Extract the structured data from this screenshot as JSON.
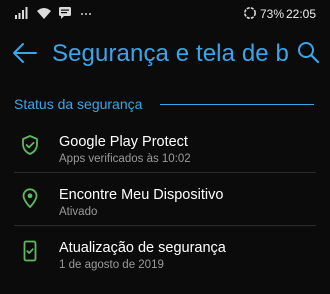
{
  "status_bar": {
    "battery_percent": "73%",
    "time": "22:05",
    "left_icons": [
      "signal-icon",
      "wifi-icon",
      "message-icon",
      "more-notifications-icon"
    ],
    "right_icons": [
      "battery-saver-icon"
    ]
  },
  "toolbar": {
    "title": "Segurança e tela de blo...",
    "back_icon": "back-arrow-icon",
    "search_icon": "search-icon"
  },
  "section": {
    "title": "Status da segurança"
  },
  "items": [
    {
      "icon": "shield-check-icon",
      "title": "Google Play Protect",
      "subtitle": "Apps verificados às 10:02"
    },
    {
      "icon": "location-pin-icon",
      "title": "Encontre Meu Dispositivo",
      "subtitle": "Ativado"
    },
    {
      "icon": "phone-update-icon",
      "title": "Atualização de segurança",
      "subtitle": "1 de agosto de 2019"
    }
  ],
  "colors": {
    "accent": "#3aa6ea",
    "icon_green": "#5fb85f",
    "background": "#0b0b0b",
    "secondary_text": "#9a9a9a"
  }
}
